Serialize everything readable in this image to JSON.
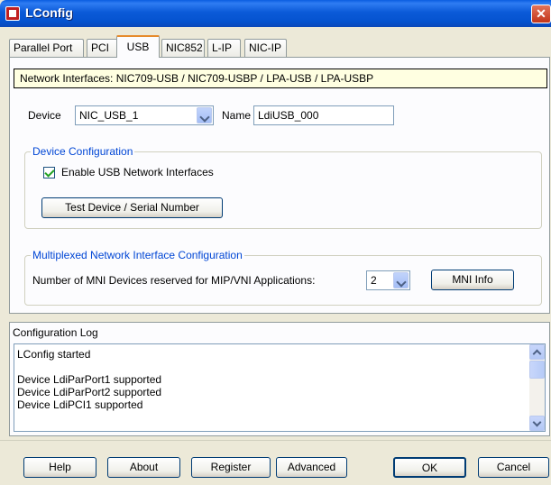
{
  "window": {
    "title": "LConfig",
    "close_glyph": "✕"
  },
  "tabs": [
    {
      "label": "Parallel Port"
    },
    {
      "label": "PCI"
    },
    {
      "label": "USB",
      "active": true
    },
    {
      "label": "NIC852"
    },
    {
      "label": "L-IP"
    },
    {
      "label": "NIC-IP"
    }
  ],
  "usb": {
    "network_interfaces": "Network Interfaces:  NIC709-USB  /  NIC709-USBP  /  LPA-USB  /  LPA-USBP",
    "device_label": "Device",
    "device_value": "NIC_USB_1",
    "name_label": "Name",
    "name_value": "LdiUSB_000",
    "device_config": {
      "title": "Device Configuration",
      "enable_label": "Enable USB Network Interfaces",
      "enable_checked": true,
      "test_button": "Test Device / Serial Number"
    },
    "mni": {
      "title": "Multiplexed Network Interface Configuration",
      "label": "Number of MNI Devices reserved for MIP/VNI Applications:",
      "count_value": "2",
      "info_button": "MNI Info"
    }
  },
  "log": {
    "title": "Configuration Log",
    "lines": [
      "LConfig started",
      "",
      "Device LdiParPort1 supported",
      "Device LdiParPort2 supported",
      "Device LdiPCI1 supported"
    ]
  },
  "buttons": {
    "help": "Help",
    "about": "About",
    "register": "Register",
    "advanced": "Advanced",
    "ok": "OK",
    "cancel": "Cancel"
  },
  "icons": {
    "app": "lconfig-app-icon",
    "close": "close-icon",
    "dropdown": "chevron-down-icon",
    "check": "check-icon",
    "scroll_up": "scroll-up-icon",
    "scroll_down": "scroll-down-icon"
  }
}
